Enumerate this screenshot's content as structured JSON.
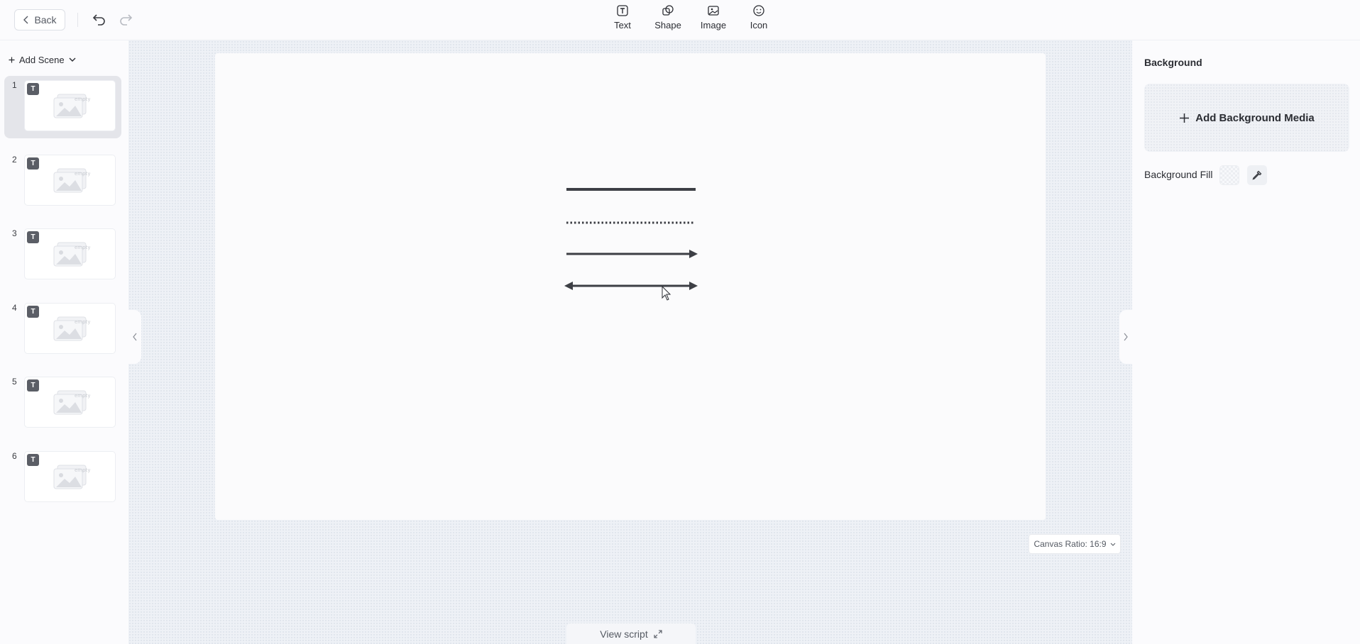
{
  "topbar": {
    "back_label": "Back",
    "tools": [
      {
        "label": "Text",
        "icon": "text-icon"
      },
      {
        "label": "Shape",
        "icon": "shape-icon"
      },
      {
        "label": "Image",
        "icon": "image-icon"
      },
      {
        "label": "Icon",
        "icon": "smiley-icon"
      }
    ]
  },
  "left_panel": {
    "add_scene_label": "Add Scene",
    "scenes": [
      {
        "number": "1",
        "badge": "T",
        "active": true
      },
      {
        "number": "2",
        "badge": "T",
        "active": false
      },
      {
        "number": "3",
        "badge": "T",
        "active": false
      },
      {
        "number": "4",
        "badge": "T",
        "active": false
      },
      {
        "number": "5",
        "badge": "T",
        "active": false
      },
      {
        "number": "6",
        "badge": "T",
        "active": false
      }
    ],
    "empty_label": "empty"
  },
  "canvas": {
    "shapes": [
      "solid-line",
      "dotted-line",
      "arrow-line",
      "double-arrow-line"
    ],
    "ratio_label": "Canvas Ratio: 16:9",
    "view_script_label": "View script"
  },
  "right_panel": {
    "title": "Background",
    "add_media_label": "Add Background Media",
    "fill_label": "Background Fill"
  },
  "colors": {
    "accent_dark": "#3d3f45",
    "canvas_bg": "#fbfbfc",
    "workspace_bg": "#eef1f6"
  }
}
